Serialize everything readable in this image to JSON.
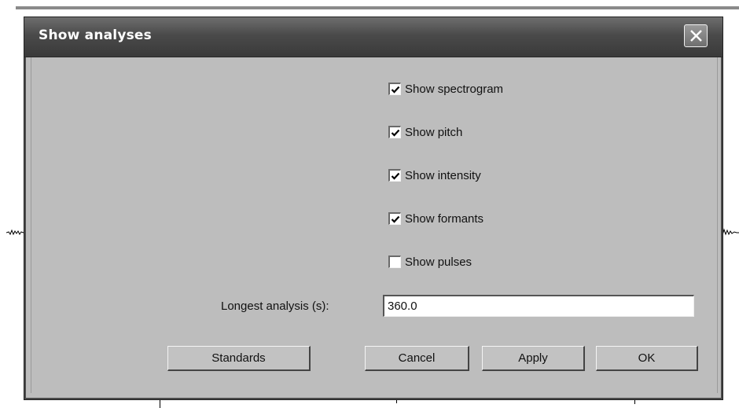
{
  "dialog": {
    "title": "Show analyses"
  },
  "options": [
    {
      "label": "Show spectrogram",
      "checked": true
    },
    {
      "label": "Show pitch",
      "checked": true
    },
    {
      "label": "Show intensity",
      "checked": true
    },
    {
      "label": "Show formants",
      "checked": true
    },
    {
      "label": "Show pulses",
      "checked": false
    }
  ],
  "longest_analysis": {
    "label": "Longest analysis (s):",
    "value": "360.0"
  },
  "buttons": {
    "standards": "Standards",
    "cancel": "Cancel",
    "apply": "Apply",
    "ok": "OK"
  }
}
